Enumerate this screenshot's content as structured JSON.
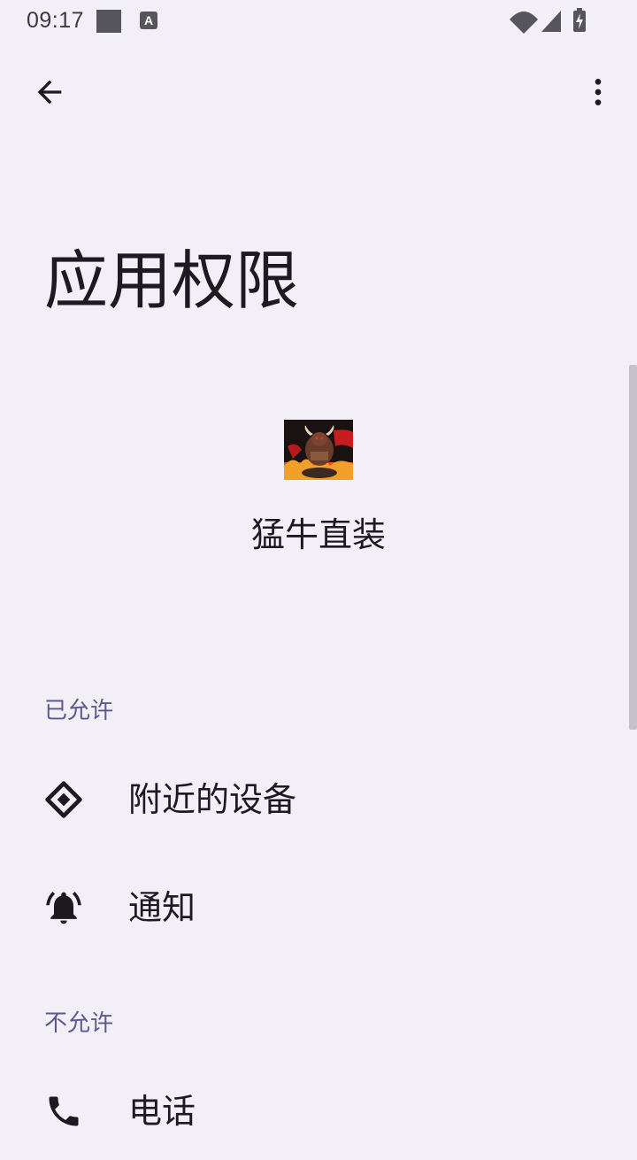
{
  "status_bar": {
    "time": "09:17",
    "notification_icon_letter": "A"
  },
  "toolbar": {
    "back_icon": "arrow-back-icon",
    "more_icon": "more-vert-icon"
  },
  "page": {
    "title": "应用权限"
  },
  "app": {
    "name": "猛牛直装",
    "icon": "bull-app-icon"
  },
  "sections": {
    "allowed": {
      "header": "已允许",
      "items": [
        {
          "label": "附近的设备",
          "icon": "nearby-devices-icon"
        },
        {
          "label": "通知",
          "icon": "notifications-bell-icon"
        }
      ]
    },
    "denied": {
      "header": "不允许",
      "items": [
        {
          "label": "电话",
          "icon": "phone-icon"
        }
      ]
    }
  },
  "colors": {
    "background": "#f3eff6",
    "section_header": "#5e5890",
    "text_primary": "#1d1b20"
  }
}
